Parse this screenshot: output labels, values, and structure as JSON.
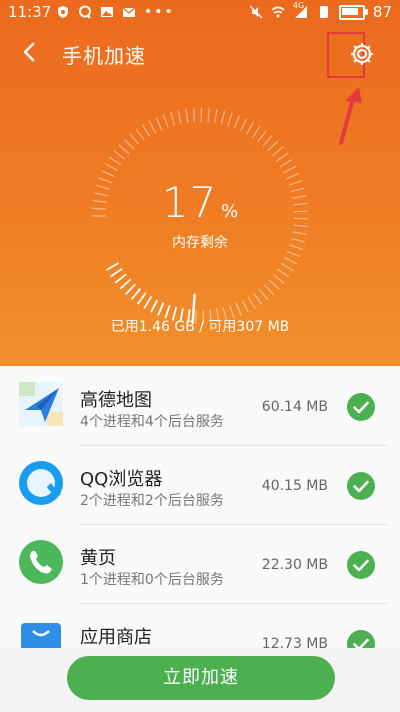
{
  "status_bar": {
    "time": "11:37",
    "signal_label": "4G",
    "battery": "87",
    "battery_level": 0.87,
    "icons_left": [
      "vpn-icon",
      "qq-icon",
      "image-icon",
      "mail-icon",
      "more-dots-icon"
    ],
    "icons_right": [
      "mute-icon",
      "wifi-icon",
      "signal-icon",
      "sim-icon",
      "battery-icon"
    ]
  },
  "app_bar": {
    "title": "手机加速",
    "back_icon": "back-arrow-icon",
    "settings_icon": "gear-icon"
  },
  "annotation": {
    "highlight_color": "#e23b3b",
    "target": "settings"
  },
  "gauge": {
    "percent": "17",
    "percent_sign": "%",
    "label": "内存剩余",
    "level": 0.17
  },
  "usage_text": "已用1.46 GB / 可用307 MB",
  "apps": [
    {
      "name": "高德地图",
      "detail": "4个进程和4个后台服务",
      "size": "60.14 MB",
      "icon": "amap-icon",
      "checked": true
    },
    {
      "name": "QQ浏览器",
      "detail": "2个进程和2个后台服务",
      "size": "40.15 MB",
      "icon": "qq-browser-icon",
      "checked": true
    },
    {
      "name": "黄页",
      "detail": "1个进程和0个后台服务",
      "size": "22.30 MB",
      "icon": "phone-icon",
      "checked": true
    },
    {
      "name": "应用商店",
      "detail": "",
      "size": "12.73 MB",
      "icon": "app-store-icon",
      "checked": true
    }
  ],
  "action_button": "立即加速",
  "colors": {
    "header_orange": "#ec6a1e",
    "check_green": "#4caf50",
    "button_green": "#4caf50"
  }
}
